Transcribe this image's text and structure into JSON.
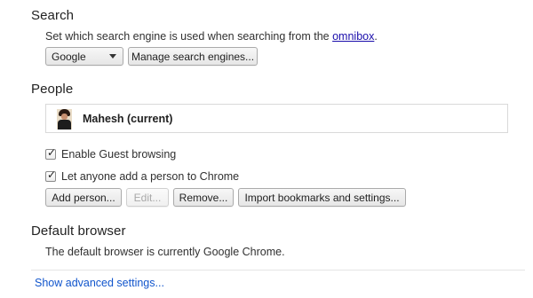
{
  "search": {
    "title": "Search",
    "description_prefix": "Set which search engine is used when searching from the ",
    "description_link": "omnibox",
    "description_suffix": ".",
    "engine_selected": "Google",
    "manage_label": "Manage search engines..."
  },
  "people": {
    "title": "People",
    "profile_name": "Mahesh (current)",
    "guest_label": "Enable Guest browsing",
    "guest_checked": true,
    "anyone_add_label": "Let anyone add a person to Chrome",
    "anyone_add_checked": true,
    "buttons": {
      "add": "Add person...",
      "edit": "Edit...",
      "remove": "Remove...",
      "import": "Import bookmarks and settings..."
    }
  },
  "default_browser": {
    "title": "Default browser",
    "status": "The default browser is currently Google Chrome."
  },
  "advanced_link": "Show advanced settings...",
  "colors": {
    "link": "#1a0dab",
    "advanced_link": "#1155cc"
  }
}
